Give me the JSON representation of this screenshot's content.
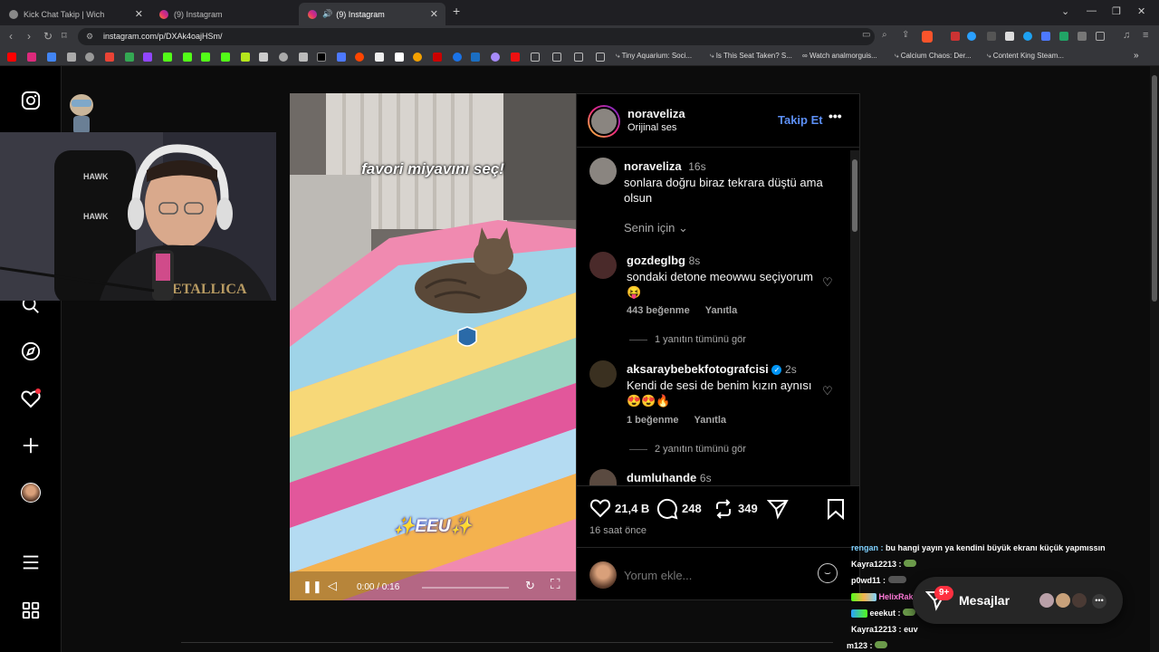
{
  "browser": {
    "tabs": [
      {
        "title": "Kick Chat Takip | Wich"
      },
      {
        "title": "(9) Instagram"
      },
      {
        "title": "(9) Instagram"
      }
    ],
    "url": "instagram.com/p/DXAk4oajHSm/",
    "bookmarks": [
      "Tiny Aquarium: Soci...",
      "Is This Seat Taken? S...",
      "Watch analmorguis...",
      "Calcium Chaos: Der...",
      "Content King Steam..."
    ]
  },
  "post": {
    "username": "noraveliza",
    "audio": "Orijinal ses",
    "follow_label": "Takip Et",
    "caption_user": "noraveliza",
    "caption_time": "16s",
    "caption_text": "sonlara doğru biraz tekrara düştü ama olsun",
    "sort_label": "Senin için",
    "video_text_top": "favori miyavını seç!",
    "video_text_bottom": "✨EEU✨",
    "video_time": "0:00 / 0:16",
    "video_progress": 0.0,
    "likes": "21,4 B",
    "comments_count": "248",
    "shares": "349",
    "posted_ago": "16 saat önce",
    "comment_placeholder": "Yorum ekle...",
    "comments": [
      {
        "user": "gozdeglbg",
        "time": "8s",
        "text": "sondaki detone meowwu seçiyorum 😝",
        "likes": "443 beğenme",
        "reply": "Yanıtla",
        "view_replies": "1 yanıtın tümünü gör"
      },
      {
        "user": "aksaraybebekfotografcisi",
        "time": "2s",
        "text": "Kendi de sesi de benim kızın aynısı 😍😍🔥",
        "likes": "1 beğenme",
        "reply": "Yanıtla",
        "view_replies": "2 yanıtın tümünü gör"
      },
      {
        "user": "dumluhande",
        "time": "6s"
      }
    ]
  },
  "chat": [
    {
      "user": "rengan :",
      "text": "bu hangi yayın ya kendini büyük ekranı küçük yapmıssın",
      "color": "#7fd1ff"
    },
    {
      "user": "Kayra12213 :",
      "text": "",
      "color": "#e8e8e8"
    },
    {
      "user": "p0wd11 :",
      "text": "",
      "color": "#e8e8e8"
    },
    {
      "user": "HelixRakici",
      "text": "",
      "color": "#ff7ad9"
    },
    {
      "user": "eeekut :",
      "text": "",
      "color": "#e8e8e8"
    },
    {
      "user": "Kayra12213 :",
      "text": "euv",
      "color": "#e8e8e8"
    },
    {
      "user": "m123 :",
      "text": "",
      "color": "#e8e8e8"
    }
  ],
  "messages": {
    "label": "Mesajlar",
    "badge": "9+"
  },
  "colors": {
    "accent": "#0095f6",
    "link": "#5c8ff5"
  }
}
